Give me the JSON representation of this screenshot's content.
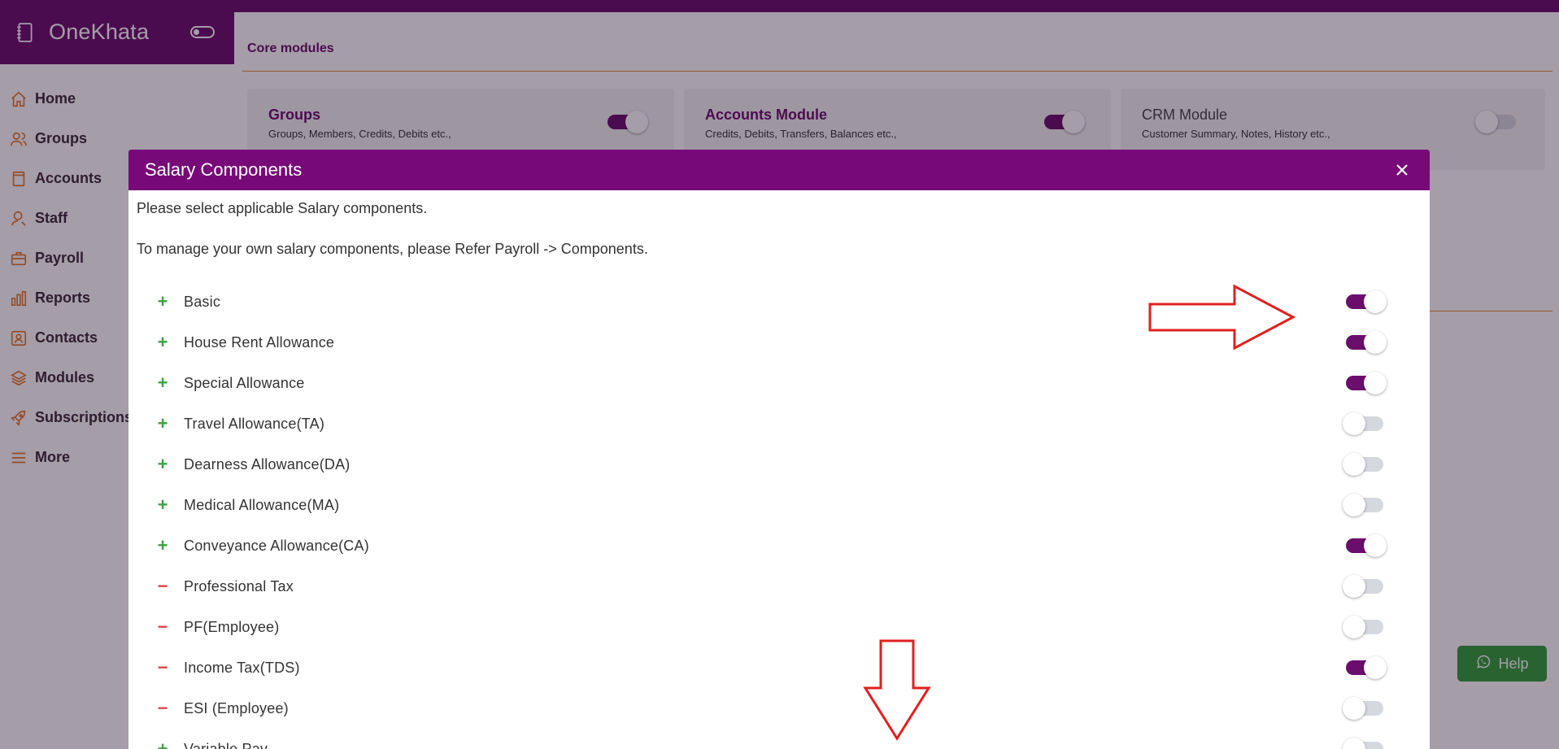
{
  "app": {
    "brand": "OneKhata"
  },
  "sidebar": {
    "items": [
      {
        "label": "Home",
        "icon": "home-icon"
      },
      {
        "label": "Groups",
        "icon": "users-icon"
      },
      {
        "label": "Accounts",
        "icon": "book-icon"
      },
      {
        "label": "Staff",
        "icon": "user-icon"
      },
      {
        "label": "Payroll",
        "icon": "briefcase-icon"
      },
      {
        "label": "Reports",
        "icon": "bar-chart-icon"
      },
      {
        "label": "Contacts",
        "icon": "contact-card-icon"
      },
      {
        "label": "Modules",
        "icon": "layers-icon"
      },
      {
        "label": "Subscriptions",
        "icon": "rocket-icon"
      },
      {
        "label": "More",
        "icon": "menu-icon"
      }
    ]
  },
  "core_modules": {
    "title": "Core modules",
    "cards": [
      {
        "title": "Groups",
        "subtitle": "Groups, Members, Credits, Debits etc.,",
        "enabled": true
      },
      {
        "title": "Accounts Module",
        "subtitle": "Credits, Debits, Transfers, Balances etc.,",
        "enabled": true
      },
      {
        "title": "CRM Module",
        "subtitle": "Customer Summary, Notes, History etc.,",
        "enabled": false
      }
    ]
  },
  "help": {
    "label": "Help"
  },
  "modal": {
    "title": "Salary Components",
    "intro": "Please select applicable Salary components.",
    "intro2": "To manage your own salary components, please Refer Payroll -> Components.",
    "components": [
      {
        "label": "Basic",
        "sign": "+",
        "enabled": true
      },
      {
        "label": "House Rent Allowance",
        "sign": "+",
        "enabled": true
      },
      {
        "label": "Special Allowance",
        "sign": "+",
        "enabled": true
      },
      {
        "label": "Travel Allowance(TA)",
        "sign": "+",
        "enabled": false
      },
      {
        "label": "Dearness Allowance(DA)",
        "sign": "+",
        "enabled": false
      },
      {
        "label": "Medical Allowance(MA)",
        "sign": "+",
        "enabled": false
      },
      {
        "label": "Conveyance Allowance(CA)",
        "sign": "+",
        "enabled": true
      },
      {
        "label": "Professional Tax",
        "sign": "−",
        "enabled": false
      },
      {
        "label": "PF(Employee)",
        "sign": "−",
        "enabled": false
      },
      {
        "label": "Income Tax(TDS)",
        "sign": "−",
        "enabled": true
      },
      {
        "label": "ESI (Employee)",
        "sign": "−",
        "enabled": false
      },
      {
        "label": "Variable Pay",
        "sign": "+",
        "enabled": false
      }
    ]
  },
  "colors": {
    "brand": "#6a0d6d",
    "accent": "#e78a3c",
    "positive": "#3aa341",
    "negative": "#e04545",
    "annotation": "#e02020"
  }
}
